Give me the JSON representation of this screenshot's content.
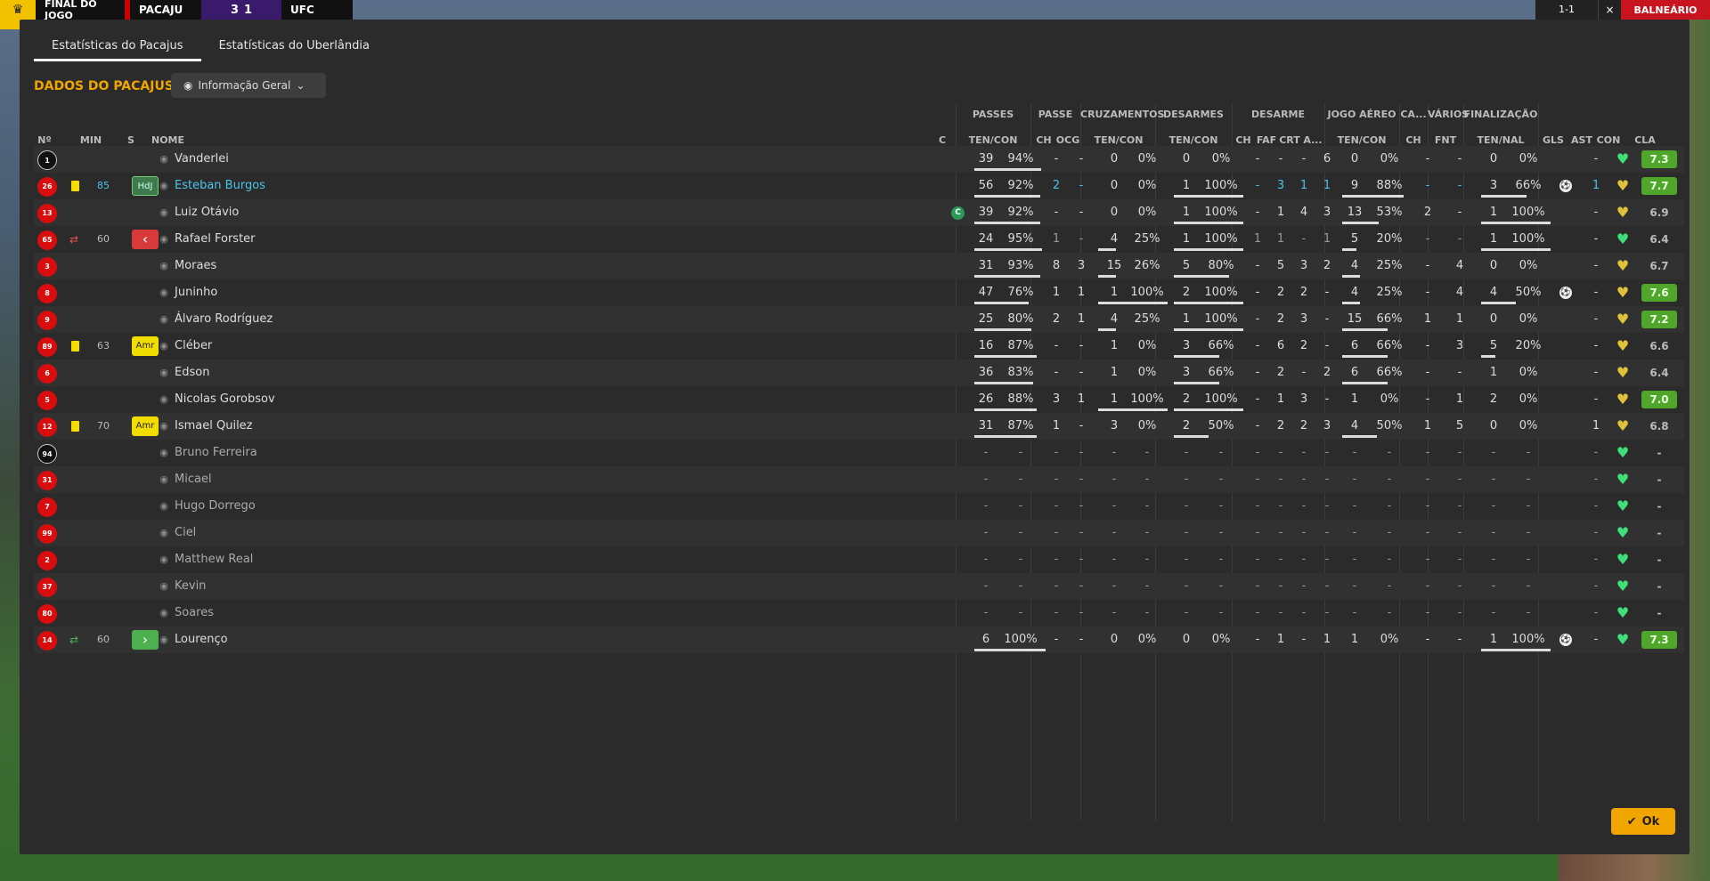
{
  "topbar": {
    "status": "FINAL DO JOGO",
    "home": "PACAJU",
    "score_home": "3",
    "score_away": "1",
    "away": "UFC",
    "clock": "1-1",
    "close": "×",
    "locker": "BALNEÁRIO"
  },
  "tabs": [
    {
      "label": "Estatísticas do Pacajus"
    },
    {
      "label": "Estatísticas do Uberlândia"
    }
  ],
  "section_title": "DADOS DO PACAJUS",
  "view_selector": {
    "icon": "eye-icon",
    "label": "Informação Geral"
  },
  "groups": {
    "passes": "PASSES",
    "passe": "PASSE",
    "cruz": "CRUZAMENTOS",
    "desarmes": "DESARMES",
    "desarme": "DESARME",
    "aereo": "JOGO AÉREO",
    "ca": "CA...",
    "varios": "VÁRIOS",
    "final": "FINALIZAÇÃO"
  },
  "headers": {
    "no": "Nº",
    "min": "MIN",
    "s": "S",
    "name": "NOME",
    "c": "C",
    "pas_tc": "TEN/CON",
    "pas_ch": "CH",
    "pas_ocg": "OCG",
    "cru_tc": "TEN/CON",
    "des_tc": "TEN/CON",
    "d_ch": "CH",
    "d_faf": "FAF",
    "d_crt": "CRT",
    "d_a": "A...",
    "aer_tc": "TEN/CON",
    "ca_ch": "CH",
    "v_fnt": "FNT",
    "fin_tn": "TEN/NAL",
    "gls": "GLS",
    "ast": "AST",
    "con": "CON",
    "cla": "CLA"
  },
  "players": [
    {
      "no": "1",
      "min": "",
      "badge": "",
      "name": "Vanderlei",
      "p1": "39",
      "p2": "94%",
      "pch": "-",
      "pocg": "-",
      "c1": "0",
      "c2": "0%",
      "d1": "0",
      "d2": "0%",
      "dch": "-",
      "dfaf": "-",
      "dcrt": "-",
      "da": "6",
      "a1": "0",
      "a2": "0%",
      "cach": "-",
      "fnt": "-",
      "f1": "0",
      "f2": "0%",
      "gls": "",
      "ast": "-",
      "cla": "7.3"
    },
    {
      "no": "26",
      "min": "85",
      "badge": "HdJ",
      "name": "Esteban Burgos",
      "p1": "56",
      "p2": "92%",
      "pch": "2",
      "pocg": "-",
      "c1": "0",
      "c2": "0%",
      "d1": "1",
      "d2": "100%",
      "dch": "-",
      "dfaf": "3",
      "dcrt": "1",
      "da": "1",
      "a1": "9",
      "a2": "88%",
      "cach": "-",
      "fnt": "-",
      "f1": "3",
      "f2": "66%",
      "gls": "ball",
      "ast": "1",
      "cla": "7.7"
    },
    {
      "no": "13",
      "min": "",
      "badge": "",
      "name": "Luiz Otávio",
      "p1": "39",
      "p2": "92%",
      "pch": "-",
      "pocg": "-",
      "c1": "0",
      "c2": "0%",
      "d1": "1",
      "d2": "100%",
      "dch": "-",
      "dfaf": "1",
      "dcrt": "4",
      "da": "3",
      "a1": "13",
      "a2": "53%",
      "cach": "2",
      "fnt": "-",
      "f1": "1",
      "f2": "100%",
      "gls": "",
      "ast": "-",
      "cla": "6.9",
      "captain": "C"
    },
    {
      "no": "65",
      "min": "60",
      "badge": "out",
      "name": "Rafael Forster",
      "p1": "24",
      "p2": "95%",
      "pch": "1",
      "pocg": "-",
      "c1": "4",
      "c2": "25%",
      "d1": "1",
      "d2": "100%",
      "dch": "1",
      "dfaf": "1",
      "dcrt": "-",
      "da": "1",
      "a1": "5",
      "a2": "20%",
      "cach": "-",
      "fnt": "-",
      "f1": "1",
      "f2": "100%",
      "gls": "",
      "ast": "-",
      "cla": "6.4"
    },
    {
      "no": "3",
      "min": "",
      "badge": "",
      "name": "Moraes",
      "p1": "31",
      "p2": "93%",
      "pch": "8",
      "pocg": "3",
      "c1": "15",
      "c2": "26%",
      "d1": "5",
      "d2": "80%",
      "dch": "-",
      "dfaf": "5",
      "dcrt": "3",
      "da": "2",
      "a1": "4",
      "a2": "25%",
      "cach": "-",
      "fnt": "4",
      "f1": "0",
      "f2": "0%",
      "gls": "",
      "ast": "-",
      "cla": "6.7"
    },
    {
      "no": "8",
      "min": "",
      "badge": "",
      "name": "Juninho",
      "p1": "47",
      "p2": "76%",
      "pch": "1",
      "pocg": "1",
      "c1": "1",
      "c2": "100%",
      "d1": "2",
      "d2": "100%",
      "dch": "-",
      "dfaf": "2",
      "dcrt": "2",
      "da": "-",
      "a1": "4",
      "a2": "25%",
      "cach": "-",
      "fnt": "4",
      "f1": "4",
      "f2": "50%",
      "gls": "ball",
      "ast": "-",
      "cla": "7.6"
    },
    {
      "no": "9",
      "min": "",
      "badge": "",
      "name": "Álvaro Rodríguez",
      "p1": "25",
      "p2": "80%",
      "pch": "2",
      "pocg": "1",
      "c1": "4",
      "c2": "25%",
      "d1": "1",
      "d2": "100%",
      "dch": "-",
      "dfaf": "2",
      "dcrt": "3",
      "da": "-",
      "a1": "15",
      "a2": "66%",
      "cach": "1",
      "fnt": "1",
      "f1": "0",
      "f2": "0%",
      "gls": "",
      "ast": "-",
      "cla": "7.2"
    },
    {
      "no": "89",
      "min": "63",
      "badge": "Amr",
      "name": "Cléber",
      "p1": "16",
      "p2": "87%",
      "pch": "-",
      "pocg": "-",
      "c1": "1",
      "c2": "0%",
      "d1": "3",
      "d2": "66%",
      "dch": "-",
      "dfaf": "6",
      "dcrt": "2",
      "da": "-",
      "a1": "6",
      "a2": "66%",
      "cach": "-",
      "fnt": "3",
      "f1": "5",
      "f2": "20%",
      "gls": "",
      "ast": "-",
      "cla": "6.6"
    },
    {
      "no": "6",
      "min": "",
      "badge": "",
      "name": "Edson",
      "p1": "36",
      "p2": "83%",
      "pch": "-",
      "pocg": "-",
      "c1": "1",
      "c2": "0%",
      "d1": "3",
      "d2": "66%",
      "dch": "-",
      "dfaf": "2",
      "dcrt": "-",
      "da": "2",
      "a1": "6",
      "a2": "66%",
      "cach": "-",
      "fnt": "-",
      "f1": "1",
      "f2": "0%",
      "gls": "",
      "ast": "-",
      "cla": "6.4"
    },
    {
      "no": "5",
      "min": "",
      "badge": "",
      "name": "Nicolas Gorobsov",
      "p1": "26",
      "p2": "88%",
      "pch": "3",
      "pocg": "1",
      "c1": "1",
      "c2": "100%",
      "d1": "2",
      "d2": "100%",
      "dch": "-",
      "dfaf": "1",
      "dcrt": "3",
      "da": "-",
      "a1": "1",
      "a2": "0%",
      "cach": "-",
      "fnt": "1",
      "f1": "2",
      "f2": "0%",
      "gls": "",
      "ast": "-",
      "cla": "7.0"
    },
    {
      "no": "12",
      "min": "70",
      "badge": "Amr",
      "name": "Ismael Quilez",
      "p1": "31",
      "p2": "87%",
      "pch": "1",
      "pocg": "-",
      "c1": "3",
      "c2": "0%",
      "d1": "2",
      "d2": "50%",
      "dch": "-",
      "dfaf": "2",
      "dcrt": "2",
      "da": "3",
      "a1": "4",
      "a2": "50%",
      "cach": "1",
      "fnt": "5",
      "f1": "0",
      "f2": "0%",
      "gls": "",
      "ast": "1",
      "cla": "6.8"
    },
    {
      "no": "94",
      "min": "",
      "badge": "",
      "name": "Bruno Ferreira",
      "bench": true
    },
    {
      "no": "31",
      "min": "",
      "badge": "",
      "name": "Micael",
      "bench": true
    },
    {
      "no": "7",
      "min": "",
      "badge": "",
      "name": "Hugo Dorrego",
      "bench": true
    },
    {
      "no": "99",
      "min": "",
      "badge": "",
      "name": "Ciel",
      "bench": true
    },
    {
      "no": "2",
      "min": "",
      "badge": "",
      "name": "Matthew Real",
      "bench": true
    },
    {
      "no": "37",
      "min": "",
      "badge": "",
      "name": "Kevin",
      "bench": true
    },
    {
      "no": "80",
      "min": "",
      "badge": "",
      "name": "Soares",
      "bench": true
    },
    {
      "no": "14",
      "min": "60",
      "badge": "in",
      "name": "Lourenço",
      "p1": "6",
      "p2": "100%",
      "pch": "-",
      "pocg": "-",
      "c1": "0",
      "c2": "0%",
      "d1": "0",
      "d2": "0%",
      "dch": "-",
      "dfaf": "1",
      "dcrt": "-",
      "da": "1",
      "a1": "1",
      "a2": "0%",
      "cach": "-",
      "fnt": "-",
      "f1": "1",
      "f2": "100%",
      "gls": "ball",
      "ast": "-",
      "cla": "7.3"
    }
  ],
  "ok_button": {
    "label": "Ok"
  }
}
